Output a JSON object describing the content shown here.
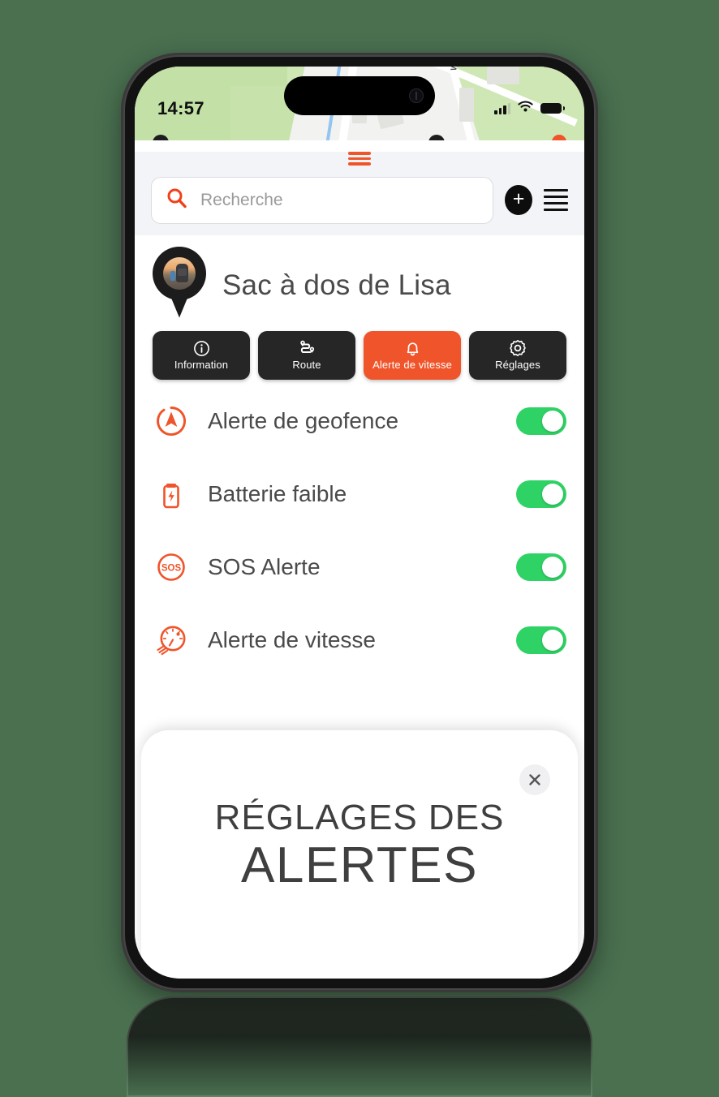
{
  "status_bar": {
    "time": "14:57",
    "cellular_icon": "signal-bars-icon",
    "wifi_icon": "wifi-icon",
    "battery_icon": "battery-full-icon"
  },
  "map": {
    "street_label": "Wa"
  },
  "header": {
    "drag_handle_icon": "drag-handle-icon",
    "search": {
      "icon": "search-icon",
      "placeholder": "Recherche",
      "value": ""
    },
    "add_button_label": "+",
    "menu_icon": "hamburger-menu-icon"
  },
  "device": {
    "name": "Sac à dos de Lisa",
    "avatar_icon": "map-pin-avatar",
    "tabs": [
      {
        "label": "Information",
        "icon": "info-circle-icon",
        "active": false
      },
      {
        "label": "Route",
        "icon": "route-icon",
        "active": false
      },
      {
        "label": "Alerte de vitesse",
        "icon": "bell-icon",
        "active": true
      },
      {
        "label": "Réglages",
        "icon": "gear-icon",
        "active": false
      }
    ]
  },
  "alerts": [
    {
      "label": "Alerte de geofence",
      "icon": "geofence-arrow-icon",
      "enabled": true
    },
    {
      "label": "Batterie faible",
      "icon": "battery-low-icon",
      "enabled": true
    },
    {
      "label": "SOS Alerte",
      "icon": "sos-icon",
      "enabled": true
    },
    {
      "label": "Alerte de vitesse",
      "icon": "speedometer-icon",
      "enabled": true
    }
  ],
  "bottom_sheet": {
    "close_icon": "close-icon",
    "title_line1": "RÉGLAGES DES",
    "title_line2": "ALERTES"
  },
  "colors": {
    "accent_orange": "#f0542a",
    "toggle_green": "#2fd365",
    "dark_button": "#262626",
    "page_background": "#4a7050",
    "map_green": "#cfe7b4"
  }
}
